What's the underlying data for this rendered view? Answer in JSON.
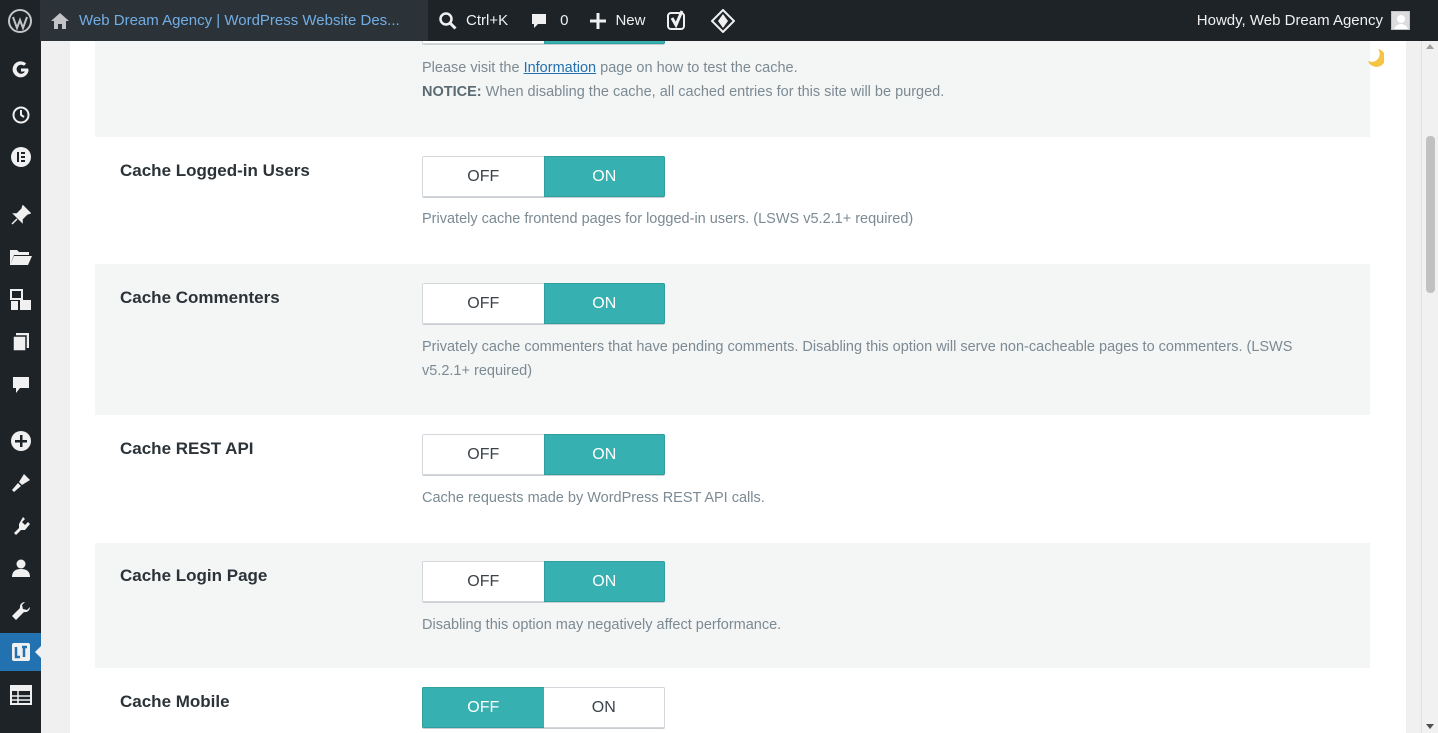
{
  "adminbar": {
    "site_title": "Web Dream Agency | WordPress Website Des...",
    "search_shortcut": "Ctrl+K",
    "comments_count": "0",
    "new_label": "New",
    "howdy": "Howdy, Web Dream Agency"
  },
  "sidebar": {
    "icons": [
      "google-icon",
      "history-icon",
      "elementor-icon",
      "pin-icon",
      "folder-icon",
      "media-icon",
      "pages-icon",
      "comments-icon",
      "add-icon",
      "appearance-icon",
      "plugins-icon",
      "users-icon",
      "tools-icon",
      "litespeed-icon",
      "table-icon"
    ]
  },
  "top_section": {
    "info_prefix": "Please visit the ",
    "info_link": "Information",
    "info_suffix": " page on how to test the cache.",
    "notice_label": "NOTICE:",
    "notice_text": " When disabling the cache, all cached entries for this site will be purged."
  },
  "settings": [
    {
      "label": "Cache Logged-in Users",
      "off": "OFF",
      "on": "ON",
      "selected": "ON",
      "desc": "Privately cache frontend pages for logged-in users. (LSWS v5.2.1+ required)"
    },
    {
      "label": "Cache Commenters",
      "off": "OFF",
      "on": "ON",
      "selected": "ON",
      "desc": "Privately cache commenters that have pending comments. Disabling this option will serve non-cacheable pages to commenters. (LSWS v5.2.1+ required)"
    },
    {
      "label": "Cache REST API",
      "off": "OFF",
      "on": "ON",
      "selected": "ON",
      "desc": "Cache requests made by WordPress REST API calls."
    },
    {
      "label": "Cache Login Page",
      "off": "OFF",
      "on": "ON",
      "selected": "ON",
      "desc": "Disabling this option may negatively affect performance."
    },
    {
      "label": "Cache Mobile",
      "off": "OFF",
      "on": "ON",
      "selected": "OFF"
    }
  ],
  "colors": {
    "accent": "#36b0b0",
    "adminbar": "#1d2327",
    "active_menu": "#2271b1"
  }
}
